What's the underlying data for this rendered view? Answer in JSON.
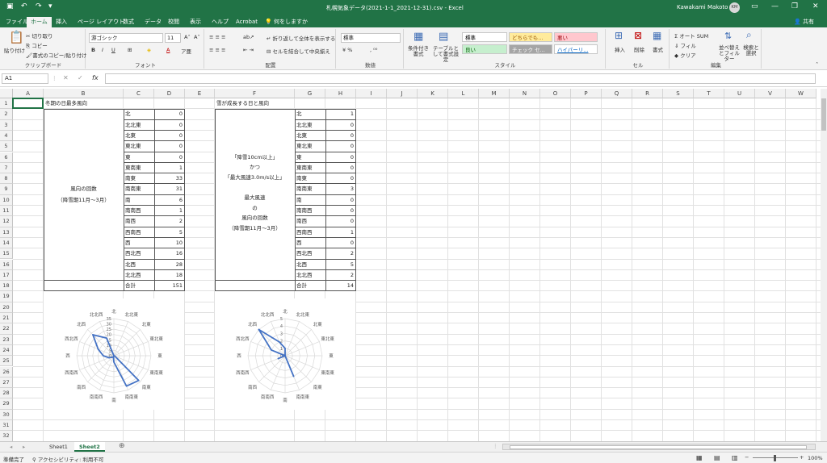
{
  "titlebar": {
    "title": "札幌気象データ(2021-1-1_2021-12-31).csv  -  Excel",
    "user": "Kawakami Makoto",
    "initials": "KM"
  },
  "tabs": [
    {
      "label": "ファイル",
      "active": false
    },
    {
      "label": "ホーム",
      "active": true
    },
    {
      "label": "挿入",
      "active": false
    },
    {
      "label": "ページ レイアウト",
      "active": false
    },
    {
      "label": "数式",
      "active": false
    },
    {
      "label": "データ",
      "active": false
    },
    {
      "label": "校閲",
      "active": false
    },
    {
      "label": "表示",
      "active": false
    },
    {
      "label": "ヘルプ",
      "active": false
    },
    {
      "label": "Acrobat",
      "active": false
    },
    {
      "label": "何をしますか",
      "active": false
    }
  ],
  "share_label": "共有",
  "ribbon": {
    "clipboard": {
      "paste": "貼り付け",
      "cut": "切り取り",
      "copy": "コピー",
      "format_painter": "書式のコピー/貼り付け",
      "group": "クリップボード"
    },
    "font": {
      "name": "游ゴシック",
      "size": "11",
      "group": "フォント"
    },
    "alignment": {
      "wrap": "折り返して全体を表示する",
      "merge": "セルを結合して中央揃え",
      "group": "配置"
    },
    "number": {
      "format": "標準",
      "group": "数値"
    },
    "styles": {
      "conditional": "条件付き書式",
      "table": "テーブルとして書式設定",
      "cells": [
        {
          "label": "標準",
          "bg": "#ffffff",
          "fg": "#000000"
        },
        {
          "label": "どちらでも...",
          "bg": "#ffeb9c",
          "fg": "#9c5700"
        },
        {
          "label": "悪い",
          "bg": "#ffc7ce",
          "fg": "#9c0006"
        },
        {
          "label": "良い",
          "bg": "#c6efce",
          "fg": "#006100"
        },
        {
          "label": "チェック セ...",
          "bg": "#a5a5a5",
          "fg": "#ffffff"
        },
        {
          "label": "ハイパーリ...",
          "bg": "#ffffff",
          "fg": "#0563c1"
        }
      ],
      "group": "スタイル"
    },
    "cells_grp": {
      "insert": "挿入",
      "delete": "削除",
      "format": "書式",
      "group": "セル"
    },
    "editing": {
      "autosum": "オート SUM",
      "fill": "フィル",
      "clear": "クリア",
      "sort": "並べ替えとフィルター",
      "find": "検索と選択",
      "group": "編集"
    }
  },
  "formula_bar": {
    "name_box": "A1",
    "formula": ""
  },
  "columns": [
    "A",
    "B",
    "C",
    "D",
    "E",
    "F",
    "G",
    "H",
    "I",
    "J",
    "K",
    "L",
    "M",
    "N",
    "O",
    "P",
    "Q",
    "R",
    "S",
    "T",
    "U",
    "V",
    "W"
  ],
  "rows": [
    "1",
    "2",
    "3",
    "4",
    "5",
    "6",
    "7",
    "8",
    "9",
    "10",
    "11",
    "12",
    "13",
    "14",
    "15",
    "16",
    "17",
    "18",
    "19",
    "20",
    "21",
    "22",
    "23",
    "24",
    "25",
    "26",
    "27",
    "28",
    "29",
    "30",
    "31",
    "32"
  ],
  "table1": {
    "title": "冬期の日最多風向",
    "label_line1": "風向の回数",
    "label_line2": "（降雪期11月～3月）",
    "directions": [
      "北",
      "北北東",
      "北東",
      "東北東",
      "東",
      "東南東",
      "南東",
      "南南東",
      "南",
      "南南西",
      "南西",
      "西南西",
      "西",
      "西北西",
      "北西",
      "北北西"
    ],
    "counts": [
      "0",
      "0",
      "0",
      "0",
      "0",
      "1",
      "33",
      "31",
      "6",
      "1",
      "2",
      "5",
      "10",
      "16",
      "28",
      "18"
    ],
    "total_label": "合計",
    "total": "151"
  },
  "table2": {
    "title": "雪が成長する日と風向",
    "label_lines": [
      "「降雪10cm以上」",
      "かつ",
      "「最大風速3.0m/s以上」",
      "",
      "最大風速",
      "の",
      "風向の回数",
      "（降雪期11月～3月）"
    ],
    "directions": [
      "北",
      "北北東",
      "北東",
      "東北東",
      "東",
      "東南東",
      "南東",
      "南南東",
      "南",
      "南南西",
      "南西",
      "西南西",
      "西",
      "西北西",
      "北西",
      "北北西"
    ],
    "counts": [
      "1",
      "0",
      "0",
      "0",
      "0",
      "0",
      "0",
      "3",
      "0",
      "0",
      "0",
      "1",
      "0",
      "2",
      "5",
      "2"
    ],
    "total_label": "合計",
    "total": "14"
  },
  "chart_data": [
    {
      "type": "radar",
      "categories": [
        "北",
        "北北東",
        "北東",
        "東北東",
        "東",
        "東南東",
        "南東",
        "南南東",
        "南",
        "南南西",
        "南西",
        "西南西",
        "西",
        "西北西",
        "北西",
        "北北西"
      ],
      "series": [
        {
          "values": [
            0,
            0,
            0,
            0,
            0,
            1,
            33,
            31,
            6,
            1,
            2,
            5,
            10,
            16,
            28,
            18
          ]
        }
      ],
      "rlim": [
        0,
        35
      ],
      "ticks": [
        "0",
        "5",
        "10",
        "15",
        "20",
        "25",
        "30",
        "35"
      ],
      "color": "#4472c4"
    },
    {
      "type": "radar",
      "categories": [
        "北",
        "北北東",
        "北東",
        "東北東",
        "東",
        "東南東",
        "南東",
        "南南東",
        "南",
        "南南西",
        "南西",
        "西南西",
        "西",
        "西北西",
        "北西",
        "北北西"
      ],
      "series": [
        {
          "values": [
            1,
            0,
            0,
            0,
            0,
            0,
            0,
            3,
            0,
            0,
            0,
            1,
            0,
            2,
            5,
            2
          ]
        }
      ],
      "rlim": [
        0,
        5
      ],
      "ticks": [
        "0",
        "1",
        "2",
        "3",
        "4",
        "5"
      ],
      "color": "#4472c4"
    }
  ],
  "sheets": [
    {
      "label": "Sheet1",
      "active": false
    },
    {
      "label": "Sheet2",
      "active": true
    }
  ],
  "status": {
    "ready": "準備完了",
    "accessibility": "アクセシビリティ: 利用不可",
    "zoom": "100%"
  }
}
